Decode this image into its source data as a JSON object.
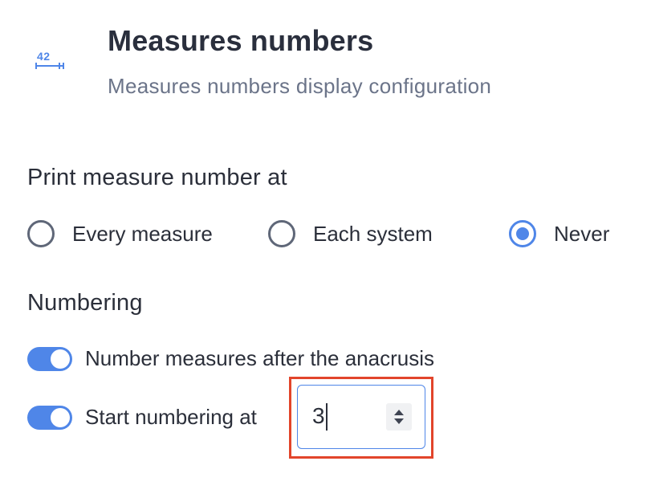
{
  "header": {
    "icon": "measure-number-icon",
    "icon_text": "42",
    "title": "Measures numbers",
    "subtitle": "Measures numbers display configuration"
  },
  "print_at": {
    "title": "Print measure number at",
    "options": [
      {
        "label": "Every measure",
        "checked": false
      },
      {
        "label": "Each system",
        "checked": false
      },
      {
        "label": "Never",
        "checked": true
      }
    ]
  },
  "numbering": {
    "title": "Numbering",
    "after_anacrusis": {
      "label": "Number measures after the anacrusis",
      "on": true
    },
    "start_at": {
      "label": "Start numbering at",
      "on": true,
      "value": "3"
    }
  },
  "colors": {
    "accent": "#4f86e8",
    "highlight": "#e2452b",
    "text": "#2b2f3a",
    "muted": "#6b7489"
  }
}
